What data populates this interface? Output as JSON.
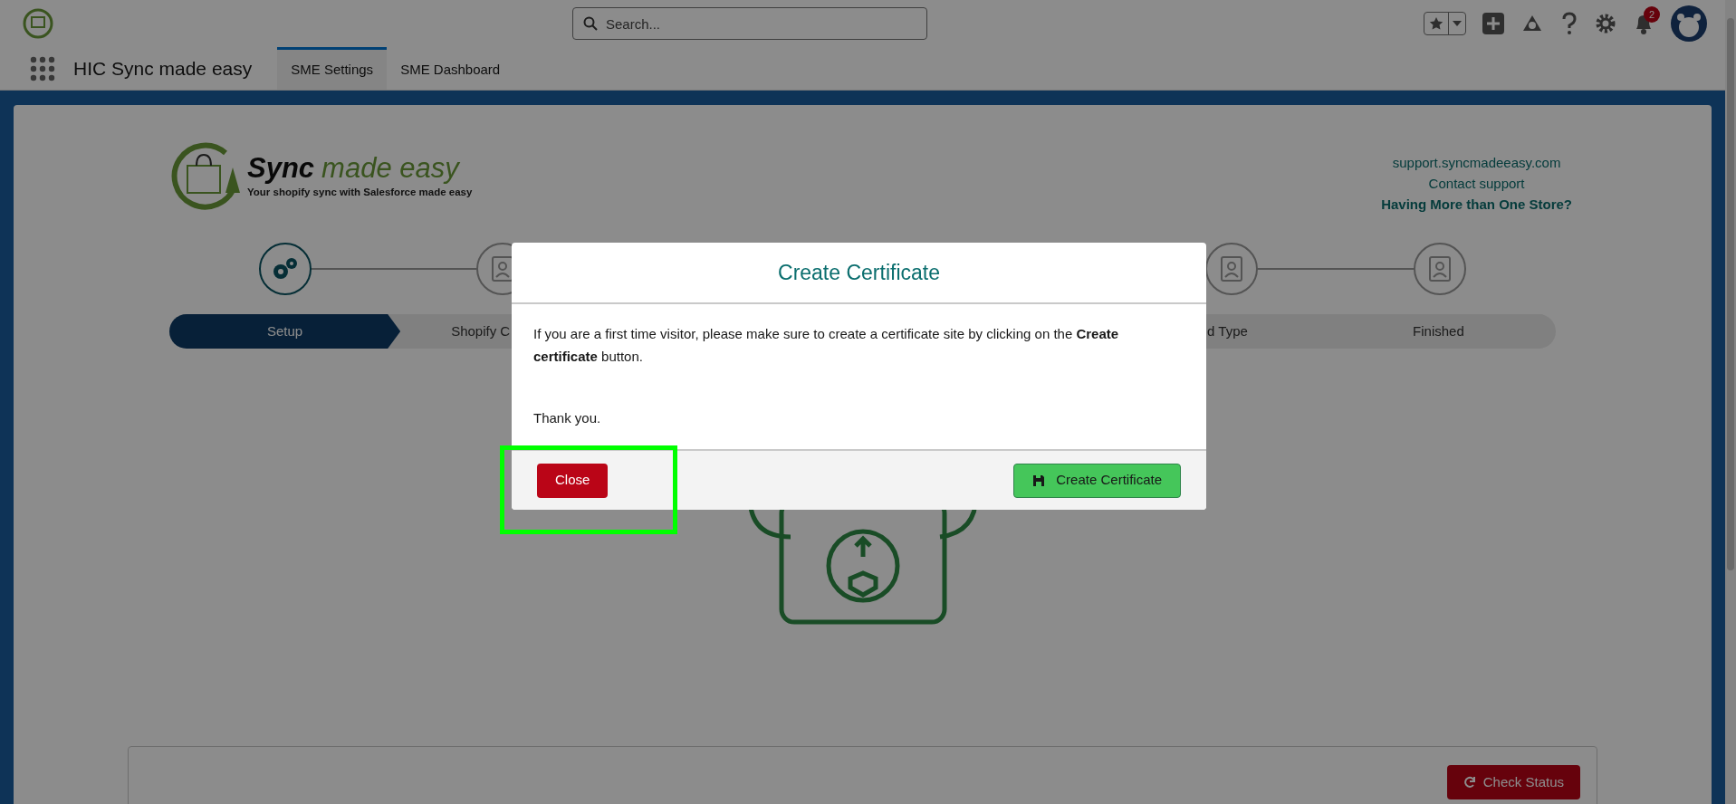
{
  "app_header": {
    "search": {
      "placeholder": "Search..."
    },
    "notifications": {
      "count": "2"
    }
  },
  "nav": {
    "app_name": "HIC Sync made easy",
    "tabs": [
      {
        "label": "SME Settings",
        "selected": true
      },
      {
        "label": "SME Dashboard",
        "selected": false
      }
    ]
  },
  "brand": {
    "name_bold": "Sync",
    "name_light": "made easy",
    "tagline": "Your shopify sync with Salesforce made easy"
  },
  "links": [
    "support.syncmadeeasy.com",
    "Contact support",
    "Having More than One Store?"
  ],
  "steps": [
    {
      "label": "Setup",
      "selected": true
    },
    {
      "label": "Shopify C",
      "selected": false
    },
    {
      "label": "d Type",
      "selected": false
    },
    {
      "label": "Finished",
      "selected": false
    }
  ],
  "status_card": {
    "button": "Check Status"
  },
  "modal": {
    "title": "Create Certificate",
    "message": "If you are a first time visitor, please make sure to create a certificate site by clicking on the **Create certificate** button.",
    "closing": "Thank you.",
    "buttons": [
      {
        "kind": "close",
        "label": "Close"
      },
      {
        "kind": "create",
        "label": "Create Certificate"
      }
    ]
  }
}
